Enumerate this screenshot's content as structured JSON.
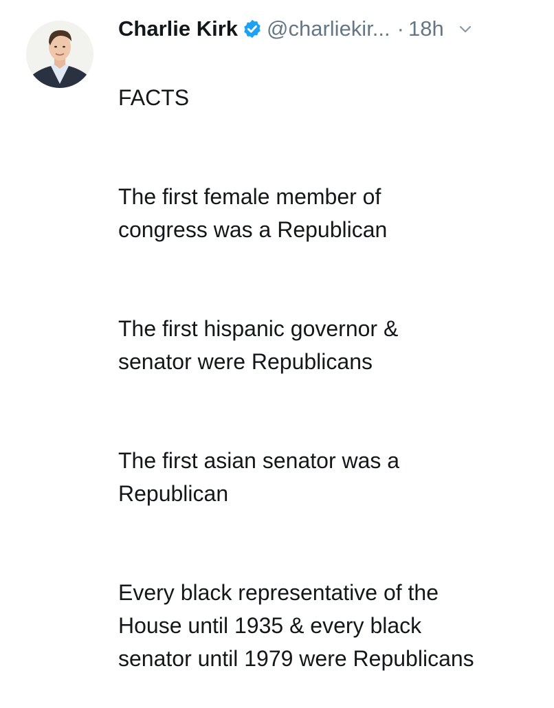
{
  "tweet": {
    "author_name": "Charlie Kirk",
    "author_handle": "@charliekir...",
    "separator": "·",
    "timestamp": "18h",
    "verified_icon": "verified-badge-icon",
    "menu_icon": "chevron-down-icon",
    "avatar": "profile-photo",
    "colors": {
      "text": "#14171a",
      "secondary": "#657786",
      "verified": "#1da1f2"
    },
    "body": {
      "heading": "FACTS",
      "paragraphs": [
        "The first female member of\ncongress was a Republican",
        "The first hispanic governor &\nsenator were Republicans",
        "The first asian senator was a\nRepublican",
        "Every black representative of the\nHouse until 1935 & every black\nsenator until 1979 were Republicans"
      ]
    }
  }
}
